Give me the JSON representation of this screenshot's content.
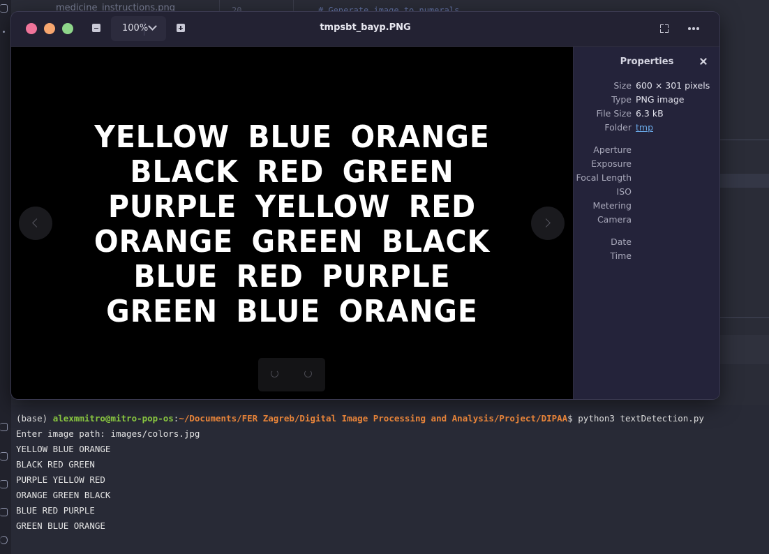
{
  "background": {
    "file_tab": "medicine_instructions.png",
    "line_number": "20",
    "code_comment": "# Generate image to numerals"
  },
  "viewer": {
    "zoom": "100%",
    "title": "tmpsbt_bayp.PNG",
    "image_lines": [
      "YELLOW BLUE ORANGE",
      "BLACK RED GREEN",
      "PURPLE YELLOW RED",
      "ORANGE GREEN BLACK",
      "BLUE RED PURPLE",
      "GREEN BLUE ORANGE"
    ],
    "properties": {
      "title": "Properties",
      "rows": [
        {
          "key": "Size",
          "value": "600 × 301 pixels"
        },
        {
          "key": "Type",
          "value": "PNG image"
        },
        {
          "key": "File Size",
          "value": "6.3 kB"
        },
        {
          "key": "Folder",
          "value": "tmp"
        },
        {
          "key": "Aperture",
          "value": ""
        },
        {
          "key": "Exposure",
          "value": ""
        },
        {
          "key": "Focal Length",
          "value": ""
        },
        {
          "key": "ISO",
          "value": ""
        },
        {
          "key": "Metering",
          "value": ""
        },
        {
          "key": "Camera",
          "value": ""
        },
        {
          "key": "Date",
          "value": ""
        },
        {
          "key": "Time",
          "value": ""
        }
      ]
    }
  },
  "terminal": {
    "prompt_env": "(base) ",
    "prompt_user": "alexmmitro@mitro-pop-os",
    "prompt_path": "~/Documents/FER Zagreb/Digital Image Processing and Analysis/Project/DIPAA",
    "command": "$ python3 textDetection.py",
    "output": [
      "Enter image path: images/colors.jpg",
      "YELLOW BLUE ORANGE",
      "BLACK RED GREEN",
      "PURPLE YELLOW RED",
      "ORANGE GREEN BLACK",
      "BLUE RED PURPLE",
      "GREEN BLUE ORANGE"
    ]
  }
}
